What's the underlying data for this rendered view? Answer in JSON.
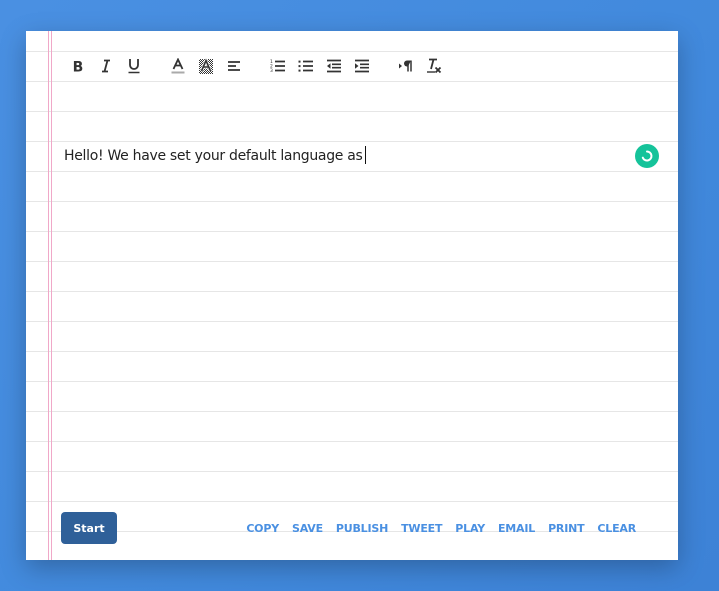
{
  "toolbar": {
    "buttons": [
      {
        "name": "bold",
        "icon": "bold-icon"
      },
      {
        "name": "italic",
        "icon": "italic-icon"
      },
      {
        "name": "underline",
        "icon": "underline-icon"
      },
      {
        "name": "font-color",
        "icon": "font-color-icon"
      },
      {
        "name": "background-color",
        "icon": "highlight-icon"
      },
      {
        "name": "align",
        "icon": "align-left-icon"
      },
      {
        "name": "ordered-list",
        "icon": "ordered-list-icon"
      },
      {
        "name": "bullet-list",
        "icon": "bullet-list-icon"
      },
      {
        "name": "outdent",
        "icon": "outdent-icon"
      },
      {
        "name": "indent",
        "icon": "indent-icon"
      },
      {
        "name": "text-direction",
        "icon": "paragraph-direction-icon"
      },
      {
        "name": "clear-format",
        "icon": "clear-format-icon"
      }
    ]
  },
  "editor": {
    "text": "Hello!  We have set your default language as"
  },
  "grammar_widget": {
    "color": "#15c39a"
  },
  "footer": {
    "start_label": "Start",
    "actions": [
      "COPY",
      "SAVE",
      "PUBLISH",
      "TWEET",
      "PLAY",
      "EMAIL",
      "PRINT",
      "CLEAR"
    ]
  },
  "colors": {
    "background": "#4a90e2",
    "accent": "#4a90e2",
    "start_button": "#2f6099",
    "margin_line": "#f0a8c8"
  }
}
